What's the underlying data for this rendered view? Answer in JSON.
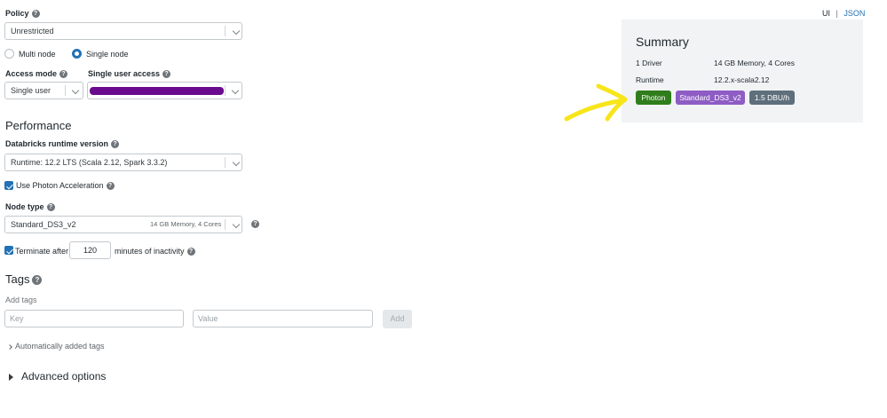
{
  "header_links": {
    "ui": "UI",
    "separator": "|",
    "json": "JSON"
  },
  "policy": {
    "label": "Policy",
    "value": "Unrestricted"
  },
  "nodes": {
    "multi": "Multi node",
    "single": "Single node"
  },
  "access_mode": {
    "label": "Access mode",
    "value": "Single user"
  },
  "single_user_access": {
    "label": "Single user access",
    "value": ""
  },
  "performance": {
    "heading": "Performance",
    "runtime_label": "Databricks runtime version",
    "runtime_value": "Runtime: 12.2 LTS (Scala 2.12, Spark 3.3.2)",
    "photon_label": "Use Photon Acceleration",
    "node_type_label": "Node type",
    "node_type_value": "Standard_DS3_v2",
    "node_type_detail": "14 GB Memory, 4 Cores",
    "terminate_label": "Terminate after",
    "terminate_minutes": "120",
    "terminate_suffix": "minutes of inactivity"
  },
  "tags": {
    "heading": "Tags",
    "add_label": "Add tags",
    "key_placeholder": "Key",
    "value_placeholder": "Value",
    "add_button": "Add",
    "auto_tags": "Automatically added tags"
  },
  "advanced": {
    "label": "Advanced options"
  },
  "summary": {
    "title": "Summary",
    "rows": [
      {
        "label": "1 Driver",
        "value": "14 GB Memory, 4 Cores"
      },
      {
        "label": "Runtime",
        "value": "12.2.x-scala2.12"
      }
    ],
    "badges": [
      {
        "label": "Photon",
        "color": "#2f7d1b"
      },
      {
        "label": "Standard_DS3_v2",
        "color": "#8e5cc4"
      },
      {
        "label": "1.5 DBU/h",
        "color": "#5f6f7c"
      }
    ]
  },
  "colors": {
    "accent": "#2272b4",
    "redaction": "#6a0a8f",
    "annotation_arrow": "#f7e51c",
    "summary_bg": "#f1f3f5"
  }
}
